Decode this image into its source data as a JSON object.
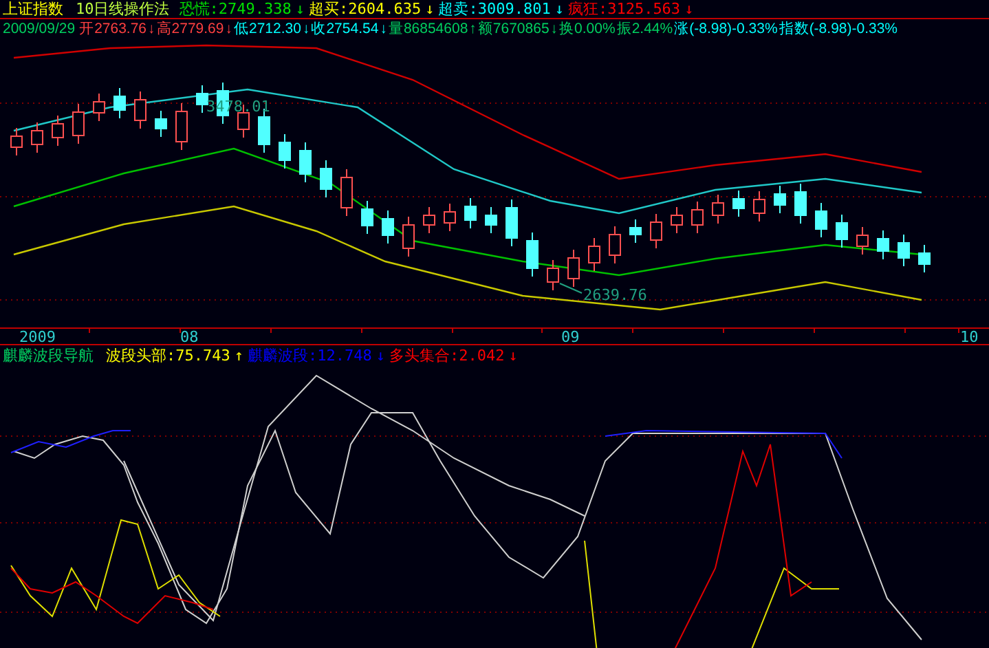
{
  "header": {
    "title": "上证指数",
    "method": "10日线操作法",
    "levels": [
      {
        "text": "恐慌:2749.338",
        "arrow": "↓",
        "color": "#00e000"
      },
      {
        "text": "超买:2604.635",
        "arrow": "↓",
        "color": "#ffff00"
      },
      {
        "text": "超卖:3009.801",
        "arrow": "↓",
        "color": "#00ffff"
      },
      {
        "text": "疯狂:3125.563",
        "arrow": "↓",
        "color": "#ff0000"
      }
    ]
  },
  "quote": {
    "date": "2009/09/29",
    "fields": [
      {
        "text": "开2763.76",
        "arrow": "↓",
        "color": "#ff4040"
      },
      {
        "text": "高2779.69",
        "arrow": "↓",
        "color": "#ff4040"
      },
      {
        "text": "低2712.30",
        "arrow": "↓",
        "color": "#00ffff"
      },
      {
        "text": "收2754.54",
        "arrow": "↓",
        "color": "#00ffff"
      },
      {
        "text": "量86854608",
        "arrow": "↑",
        "color": "#00d060"
      },
      {
        "text": "额7670865",
        "arrow": "↓",
        "color": "#00d060"
      },
      {
        "text": "换0.00%",
        "color": "#00d060"
      },
      {
        "text": "振2.44%",
        "color": "#00d060"
      },
      {
        "text": "涨(-8.98)-0.33%",
        "color": "#00ffff"
      },
      {
        "text": "指数(-8.98)-0.33%",
        "color": "#00ffff"
      }
    ]
  },
  "price_chart": {
    "high_label": "3478.01",
    "low_label": "2639.76"
  },
  "time_axis": {
    "labels": [
      "2009",
      "08",
      "09",
      "10"
    ]
  },
  "indicator": {
    "title": "麒麟波段导航",
    "lines": [
      {
        "text": "波段头部:75.743",
        "arrow": "↑",
        "color": "#ffff00"
      },
      {
        "text": "麒麟波段:12.748",
        "arrow": "↓",
        "color": "#0000ff"
      },
      {
        "text": "多头集合:2.042",
        "arrow": "↓",
        "color": "#ff0000"
      }
    ]
  }
}
